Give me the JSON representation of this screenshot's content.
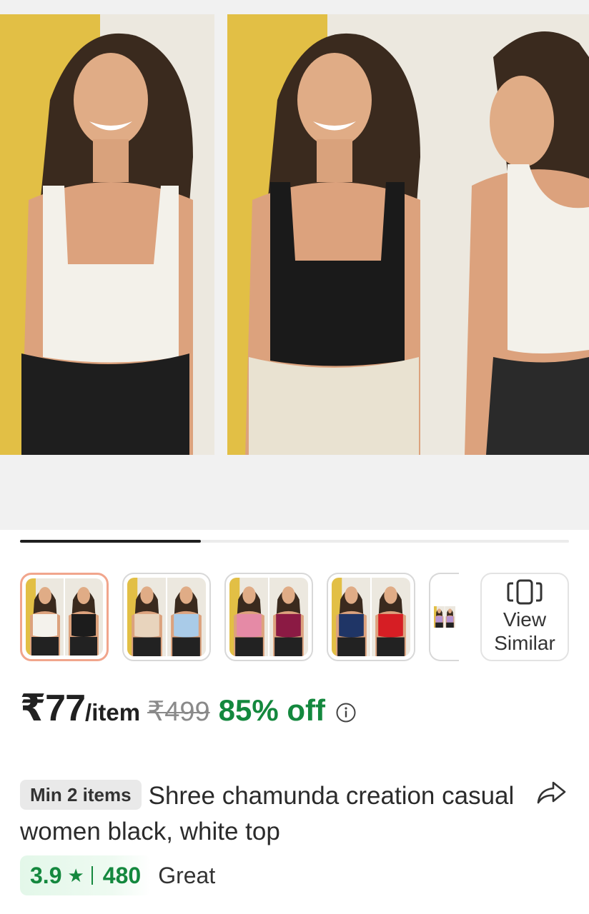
{
  "gallery": {
    "photos": [
      {
        "top_color": "#f3f1ea",
        "bottom_color": "#1e1e1e"
      },
      {
        "top_color": "#1a1a1a",
        "bottom_color": "#e9e2d1"
      },
      {
        "top_color": "#f3f1ea",
        "bottom_color": "#2a2a2a"
      }
    ],
    "progress_fraction": 0.33
  },
  "thumbnails": {
    "items": [
      {
        "left_color": "#f4f2ec",
        "right_color": "#1c1c1c",
        "selected": true
      },
      {
        "left_color": "#e8d4bd",
        "right_color": "#a9cbe8",
        "selected": false
      },
      {
        "left_color": "#e58aa6",
        "right_color": "#8b1a44",
        "selected": false
      },
      {
        "left_color": "#1f3566",
        "right_color": "#d61e24",
        "selected": false
      },
      {
        "left_color": "#b694d2",
        "right_color": "#b694d2",
        "selected": false
      }
    ],
    "view_similar_label": "View Similar"
  },
  "price": {
    "current": "₹77",
    "unit": "/item",
    "mrp": "₹499",
    "discount": "85% off"
  },
  "product": {
    "min_badge": "Min 2 items",
    "title": "Shree chamunda creation casual women black, white top"
  },
  "rating": {
    "score": "3.9",
    "star": "★",
    "count": "480",
    "label": "Great"
  },
  "colors": {
    "accent_green": "#14883e",
    "selected_border": "#f1a58c",
    "wall_yellow": "#e2bf45"
  },
  "icons": [
    "info-icon",
    "share-icon",
    "view-similar-icon",
    "star-icon"
  ]
}
